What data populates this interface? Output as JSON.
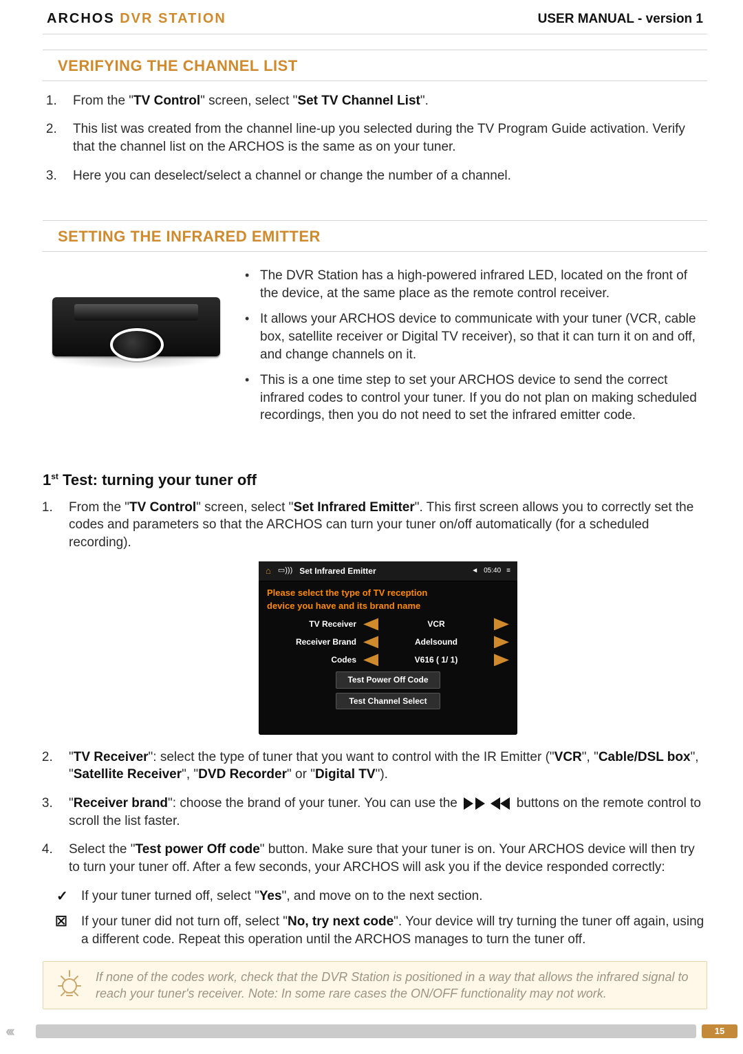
{
  "header": {
    "brand_black": "ARCHOS",
    "brand_orange": "DVR STATION",
    "manual": "USER MANUAL - version 1"
  },
  "section1": {
    "title": "VERIFYING THE CHANNEL LIST",
    "items": [
      {
        "pre": "From the \"",
        "b1": "TV Control",
        "mid": "\" screen, select \"",
        "b2": "Set TV Channel List",
        "post": "\"."
      },
      {
        "text": "This list was created from the channel line-up you selected during the TV Program Guide activation. Verify that the channel list on the ARCHOS is the same as on your tuner."
      },
      {
        "text": "Here you can deselect/select a channel or change the number of a channel."
      }
    ]
  },
  "section2": {
    "title": "SETTING THE INFRARED EMITTER",
    "bullets": [
      "The DVR Station has a high-powered infrared LED, located on the front of the device, at the same place as the remote control receiver.",
      "It allows your ARCHOS device to communicate with your tuner (VCR, cable box, satellite receiver or Digital TV receiver), so that it can turn it on and off, and change channels on it.",
      "This is a one time step to set your ARCHOS device to send the correct infrared codes to control your tuner. If you do not plan on making scheduled recordings, then you do not need to set the infrared emitter code."
    ]
  },
  "test": {
    "heading_pre": "1",
    "heading_sup": "st",
    "heading_rest": " Test: turning your tuner off",
    "step1": {
      "pre": "From the \"",
      "b1": "TV Control",
      "mid": "\" screen, select \"",
      "b2": "Set Infrared Emitter",
      "post": "\". This first screen allows you to correctly set the codes and parameters so that the ARCHOS can turn your tuner on/off automatically (for a scheduled recording)."
    },
    "screenshot": {
      "title": "Set Infrared Emitter",
      "clock": "05:40",
      "prompt1": "Please select the type of TV reception",
      "prompt2": "device you have and its brand name",
      "rows": [
        {
          "label": "TV Receiver",
          "value": "VCR"
        },
        {
          "label": "Receiver Brand",
          "value": "Adelsound"
        },
        {
          "label": "Codes",
          "value": "V616 ( 1/ 1)"
        }
      ],
      "btn1": "Test Power Off Code",
      "btn2": "Test Channel Select"
    },
    "step2": {
      "pre": "\"",
      "b1": "TV Receiver",
      "mid": "\": select the type of tuner that you want to control with the IR Emitter (\"",
      "b2": "VCR",
      "mid2": "\", \"",
      "b3": "Cable/DSL box",
      "mid3": "\", \"",
      "b4": "Satellite Receiver",
      "mid4": "\", \"",
      "b5": "DVD Recorder",
      "mid5": "\" or \"",
      "b6": "Digital TV",
      "post": "\")."
    },
    "step3": {
      "pre": "\"",
      "b1": "Receiver brand",
      "mid": "\": choose the brand of your tuner. You can use the ",
      "post": " buttons on the remote control to scroll the list faster."
    },
    "step4": {
      "pre": "Select the \"",
      "b1": "Test power Off code",
      "post": "\" button. Make sure that your tuner is on. Your ARCHOS device will then try to turn your tuner off. After a few seconds, your ARCHOS will ask you if the device responded correctly:"
    },
    "check": {
      "pre": "If your tuner turned off, select \"",
      "b1": "Yes",
      "post": "\", and move on to the next section."
    },
    "cross": {
      "pre": "If your tuner did not turn off, select \"",
      "b1": "No, try next code",
      "post": "\". Your device will try turning the tuner off again, using a different code. Repeat this operation until the ARCHOS manages to turn the tuner off."
    }
  },
  "tip": "If none of the codes work, check that the DVR Station is positioned in a way that allows the infrared signal to reach your tuner's receiver. Note: In some rare cases the ON/OFF functionality may not work.",
  "footer": {
    "page": "15"
  }
}
